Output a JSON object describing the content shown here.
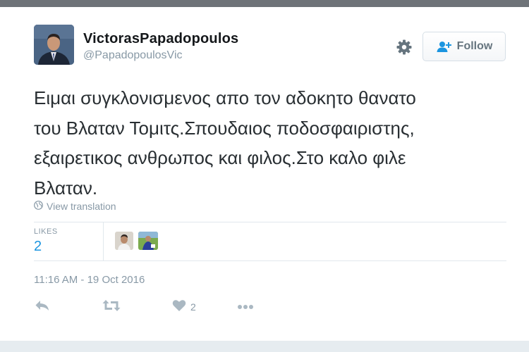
{
  "tweet": {
    "author": {
      "display_name": "VictorasPapadopoulos",
      "handle": "@PapadopoulosVic"
    },
    "follow_label": "Follow",
    "text": "Ειμαι συγκλονισμενος απο τον αδοκητο θανατο\nτου Βλαταν Τομιτς.Σπουδαιος ποδοσφαιριστης,\nεξαιρετικος ανθρωπος και φιλος.Στο καλο φιλε\nΒλαταν.",
    "view_translation_label": "View translation",
    "stats": {
      "likes_label": "LIKES",
      "likes_count": "2"
    },
    "timestamp": "11:16 AM - 19 Oct 2016",
    "actions": {
      "like_count": "2"
    }
  },
  "icons": [
    "gear-icon",
    "follow-person-icon",
    "globe-icon",
    "reply-icon",
    "retweet-icon",
    "heart-icon",
    "more-icon"
  ],
  "colors": {
    "link_blue": "#1b95e0",
    "muted_text": "#8899a6",
    "icon_gray": "#aab8c2"
  }
}
